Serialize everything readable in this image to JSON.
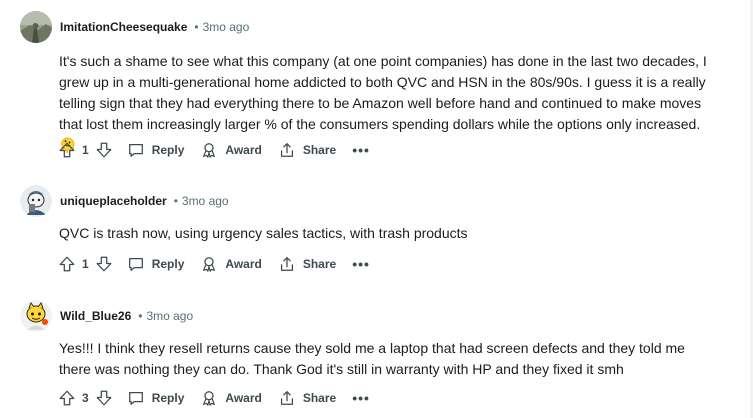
{
  "comments": [
    {
      "username": "ImitationCheesequake",
      "separator": "•",
      "time": "3mo ago",
      "text": "It's such a shame to see what this company (at one point companies) has done in the last two decades, I grew up in a multi-generational home addicted to both QVC and HSN in the 80s/90s. I guess it is a really telling sign that they had everything there to be Amazon well before hand and continued to make moves that lost them increasingly larger % of the consumers spending dollars while the options only increased. 🫠",
      "votes": "1",
      "reply_label": "Reply",
      "award_label": "Award",
      "share_label": "Share",
      "more_label": "•••",
      "avatar_icon": "landscape-avatar-icon"
    },
    {
      "username": "uniqueplaceholder",
      "separator": "•",
      "time": "3mo ago",
      "text": "QVC is trash now, using urgency sales tactics, with trash products",
      "votes": "1",
      "reply_label": "Reply",
      "award_label": "Award",
      "share_label": "Share",
      "more_label": "•••",
      "avatar_icon": "snoo-avatar-icon"
    },
    {
      "username": "Wild_Blue26",
      "separator": "•",
      "time": "3mo ago",
      "text": "Yes!!! I think they resell returns cause they sold me a laptop that had screen defects and they told me there was nothing they can do. Thank God it's still in warranty with HP and they fixed it smh",
      "votes": "3",
      "reply_label": "Reply",
      "award_label": "Award",
      "share_label": "Share",
      "more_label": "•••",
      "avatar_icon": "snoo-yellow-avatar-icon"
    }
  ],
  "colors": {
    "text": "#1c1c1c",
    "meta": "#576f76",
    "action": "#3e4a4f",
    "time_link": "#0079d3"
  }
}
